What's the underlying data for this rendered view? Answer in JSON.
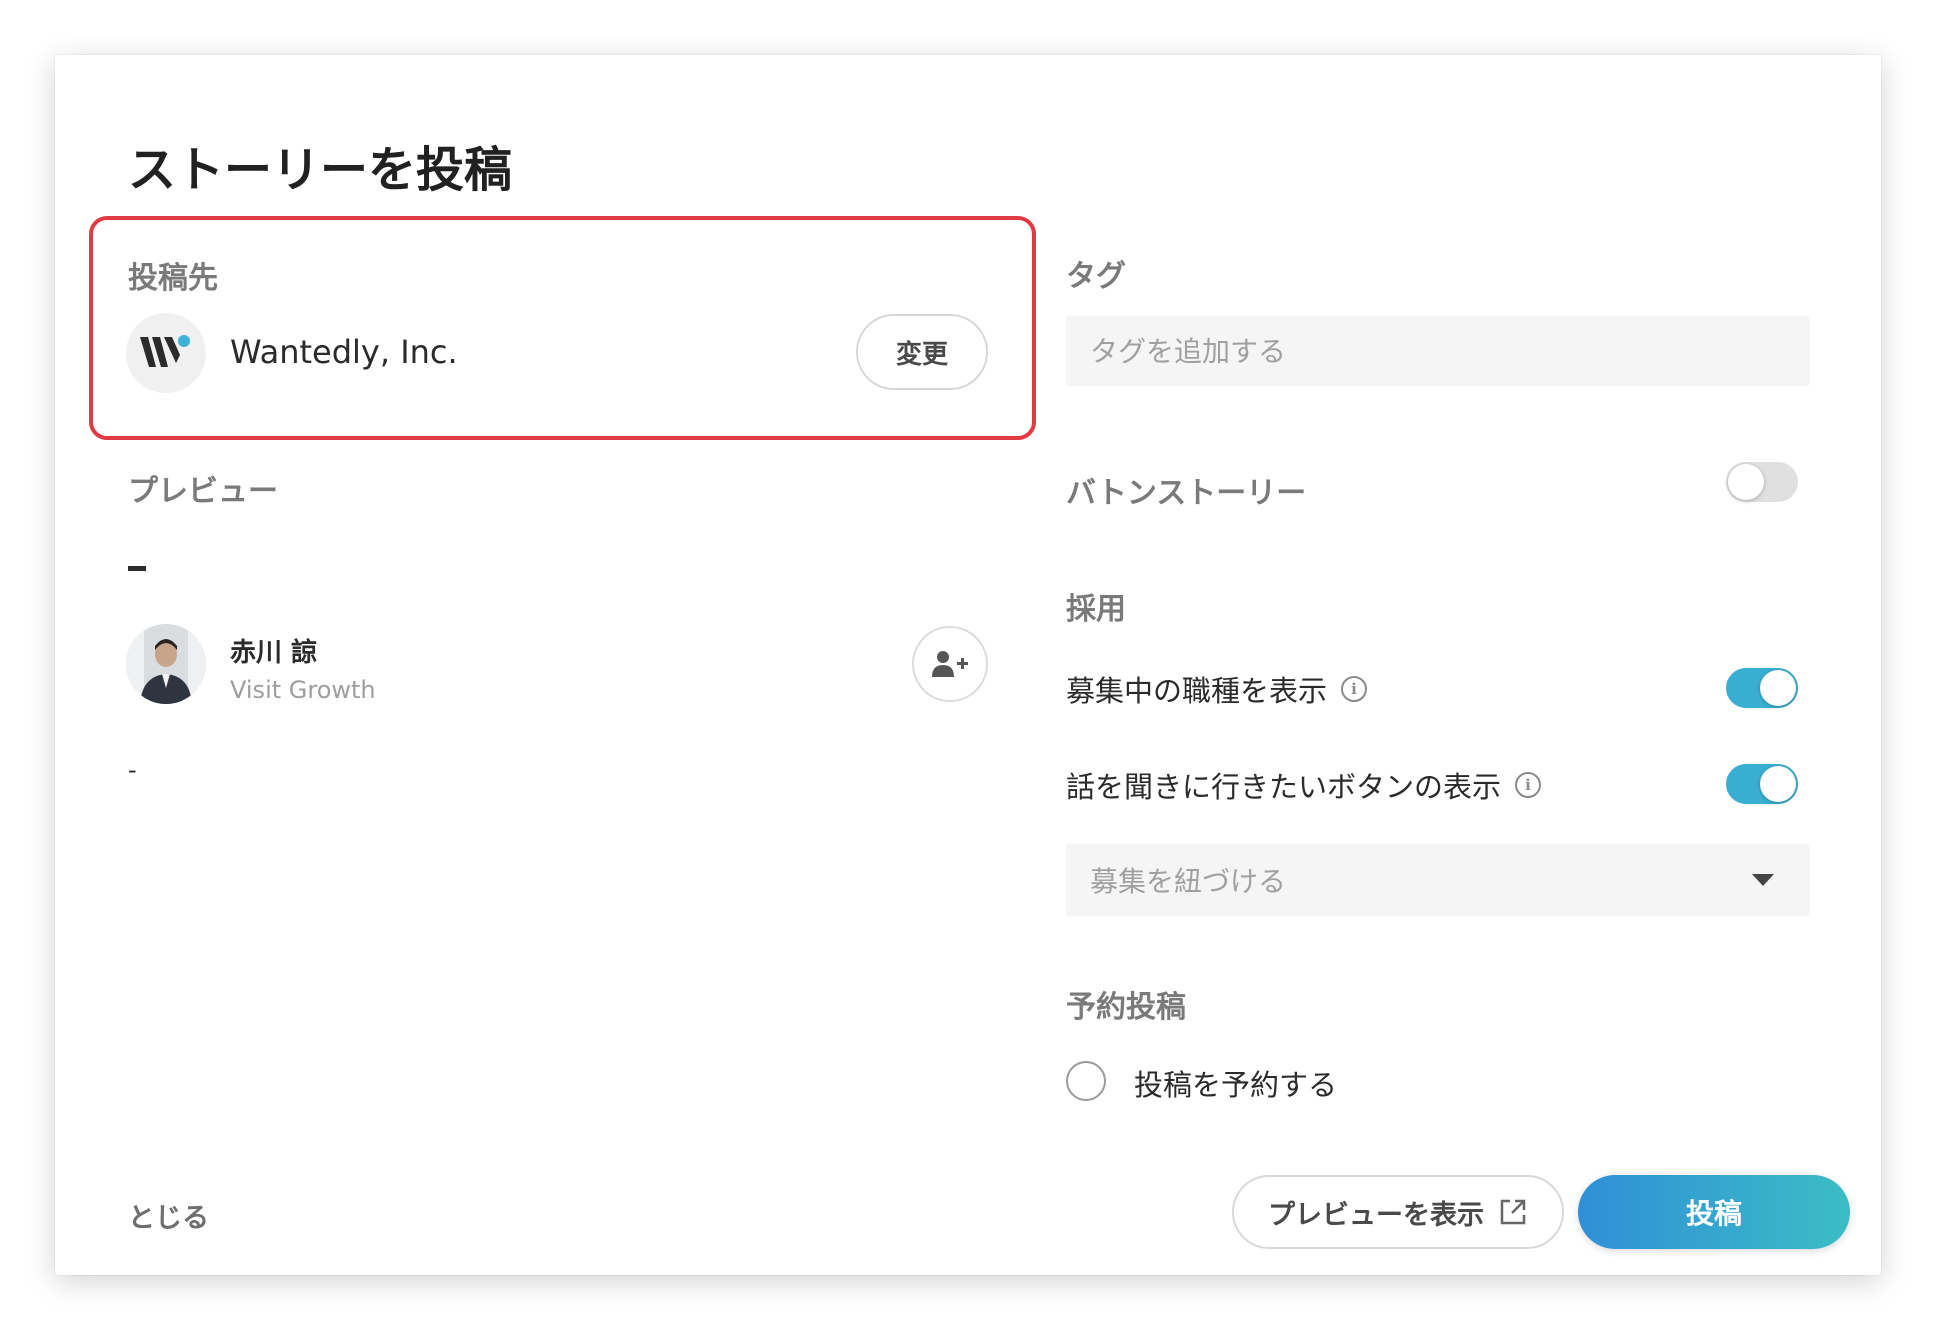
{
  "dialog": {
    "title": "ストーリーを投稿"
  },
  "destination": {
    "label": "投稿先",
    "company_name": "Wantedly, Inc.",
    "change_label": "変更"
  },
  "preview": {
    "label": "プレビュー",
    "story_title": "-",
    "author_name": "赤川 諒",
    "author_company": "Visit Growth",
    "body": "-"
  },
  "tags": {
    "label": "タグ",
    "placeholder": "タグを追加する"
  },
  "baton_story": {
    "label": "バトンストーリー",
    "enabled": false
  },
  "recruiting": {
    "label": "採用",
    "show_open_positions_label": "募集中の職種を表示",
    "show_open_positions": true,
    "show_want_to_talk_button_label": "話を聞きに行きたいボタンの表示",
    "show_want_to_talk_button": true,
    "link_project_placeholder": "募集を紐づける"
  },
  "schedule": {
    "label": "予約投稿",
    "option_label": "投稿を予約する",
    "checked": false
  },
  "footer": {
    "close_label": "とじる",
    "preview_button_label": "プレビューを表示",
    "post_button_label": "投稿"
  },
  "colors": {
    "accent": "#3aaed1",
    "highlight_border": "#e03a43",
    "logo_dot": "#3bb3d6"
  },
  "icons": {
    "company_logo": "wantedly-logo",
    "add_user": "add-user-icon",
    "info": "info-icon",
    "dropdown": "caret-down-icon",
    "external_link": "external-link-icon"
  }
}
